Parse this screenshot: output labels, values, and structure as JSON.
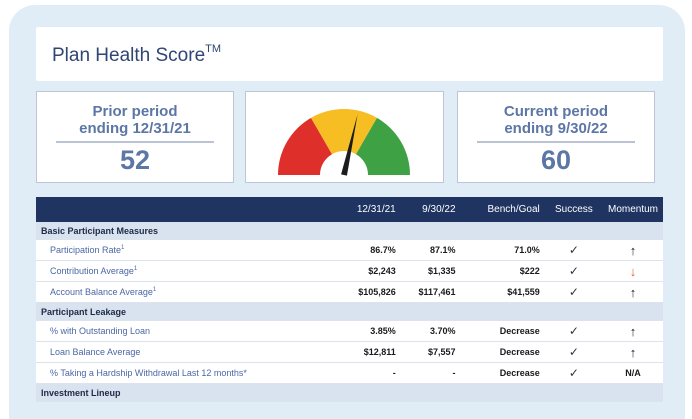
{
  "header": {
    "title": "Plan Health Score",
    "title_sup": "TM"
  },
  "prior_card": {
    "label_line1": "Prior period",
    "label_line2": "ending 12/31/21",
    "score": "52"
  },
  "current_card": {
    "label_line1": "Current period",
    "label_line2": "ending 9/30/22",
    "score": "60"
  },
  "gauge": {
    "zone_colors": [
      "#df2f2a",
      "#f6be23",
      "#3ea245"
    ],
    "needle_color": "#1c1c1c",
    "level": 0.57
  },
  "table": {
    "columns": [
      "",
      "12/31/21",
      "9/30/22",
      "Bench/Goal",
      "Success",
      "Momentum"
    ],
    "sections": [
      {
        "name": "Basic Participant Measures",
        "rows": [
          {
            "label": "Participation Rate",
            "sup": "1",
            "v1": "86.7%",
            "v2": "87.1%",
            "bench": "71.0%",
            "success": "✓",
            "momentum": "↑",
            "momentum_state": "up"
          },
          {
            "label": "Contribution Average",
            "sup": "1",
            "v1": "$2,243",
            "v2": "$1,335",
            "bench": "$222",
            "success": "✓",
            "momentum": "↓",
            "momentum_state": "down"
          },
          {
            "label": "Account Balance Average",
            "sup": "1",
            "v1": "$105,826",
            "v2": "$117,461",
            "bench": "$41,559",
            "success": "✓",
            "momentum": "↑",
            "momentum_state": "up"
          }
        ]
      },
      {
        "name": "Participant Leakage",
        "rows": [
          {
            "label": "% with Outstanding Loan",
            "sup": "",
            "v1": "3.85%",
            "v2": "3.70%",
            "bench": "Decrease",
            "success": "✓",
            "momentum": "↑",
            "momentum_state": "up"
          },
          {
            "label": "Loan Balance Average",
            "sup": "",
            "v1": "$12,811",
            "v2": "$7,557",
            "bench": "Decrease",
            "success": "✓",
            "momentum": "↑",
            "momentum_state": "up"
          },
          {
            "label": "% Taking a Hardship Withdrawal Last 12 months*",
            "sup": "",
            "v1": "-",
            "v2": "-",
            "bench": "Decrease",
            "success": "✓",
            "momentum": "N/A",
            "momentum_state": "na"
          }
        ]
      },
      {
        "name": "Investment Lineup",
        "rows": []
      }
    ]
  }
}
